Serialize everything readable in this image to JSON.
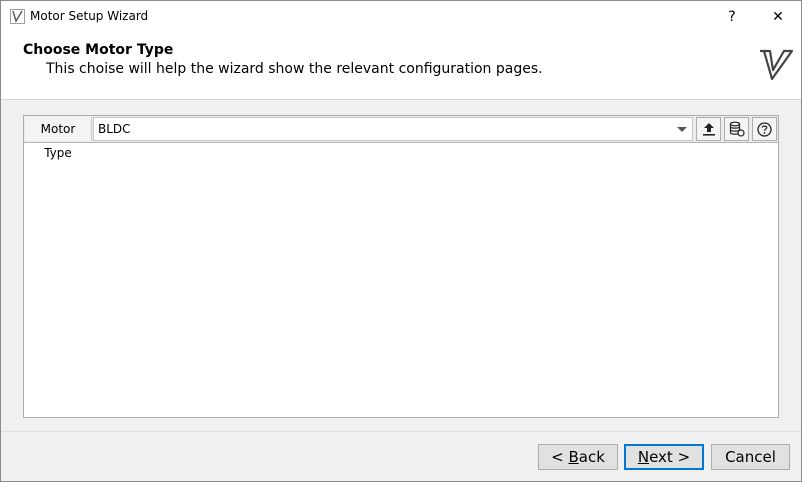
{
  "window": {
    "title": "Motor Setup Wizard",
    "help_glyph": "?",
    "close_glyph": "✕"
  },
  "header": {
    "title": "Choose Motor Type",
    "subtitle": "This choise will help the wizard show the relevant configuration pages.",
    "logo_icon": "vesc-logo-icon"
  },
  "motor_type": {
    "label": "Motor Type",
    "selected": "BLDC",
    "buttons": [
      {
        "name": "upload-icon"
      },
      {
        "name": "database-reset-icon"
      },
      {
        "name": "help-circle-icon"
      }
    ]
  },
  "footer": {
    "back": {
      "prefix": "< ",
      "mnemonic": "B",
      "rest": "ack"
    },
    "next": {
      "mnemonic": "N",
      "rest": "ext >"
    },
    "cancel": "Cancel"
  },
  "colors": {
    "accent": "#0078d7",
    "panel_bg": "#f0f0f0"
  }
}
